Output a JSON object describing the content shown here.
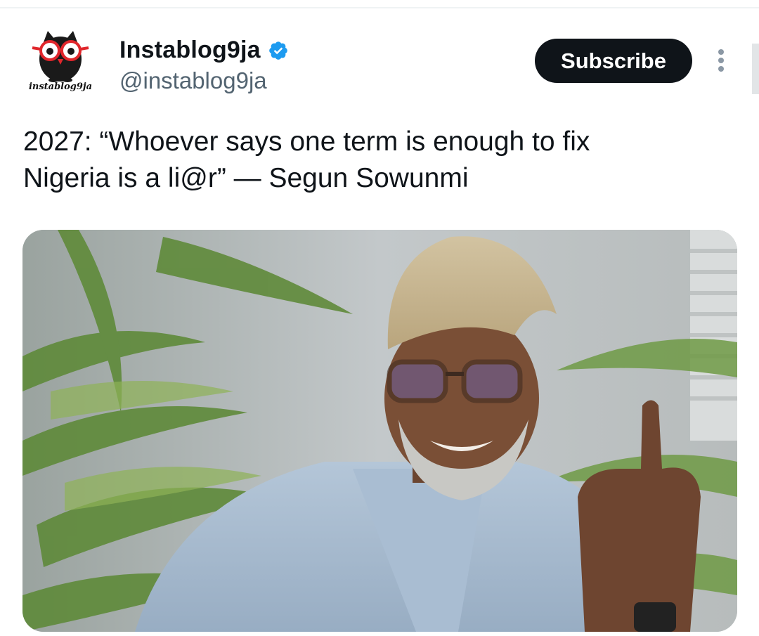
{
  "tweet": {
    "author": {
      "display_name": "Instablog9ja",
      "handle": "@instablog9ja",
      "verified": true,
      "avatar_wordmark": "instablog9ja",
      "avatar_icon": "owl-with-red-glasses-icon"
    },
    "subscribe_label": "Subscribe",
    "more_icon": "more-vertical-icon",
    "text_line1": "2027: “Whoever says one term is enough to fix",
    "text_line2": "Nigeria is a li@r” — Segun Sowunmi",
    "media": {
      "kind": "photo",
      "alt_icon": "photo-man-with-glasses-raising-finger"
    }
  },
  "colors": {
    "text_primary": "#0f1419",
    "text_secondary": "#536471",
    "button_bg": "#0f1419",
    "button_text": "#ffffff",
    "verified_blue": "#1d9bf0",
    "divider": "#eff3f4"
  }
}
